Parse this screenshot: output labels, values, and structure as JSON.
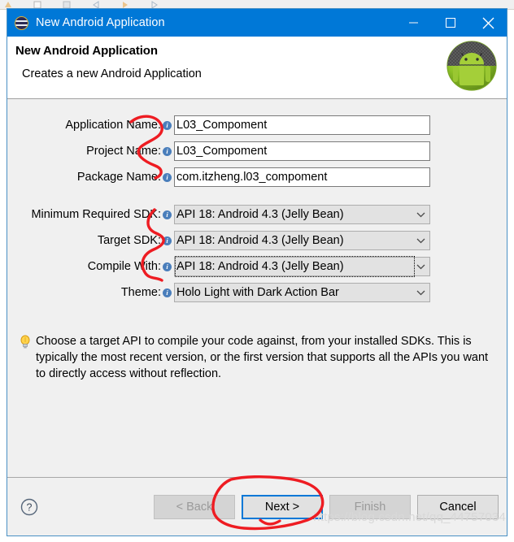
{
  "window": {
    "title": "New Android Application",
    "icon": "eclipse-icon",
    "controls": {
      "minimize": "minimize-icon",
      "maximize": "maximize-icon",
      "close": "close-icon"
    }
  },
  "header": {
    "title": "New Android Application",
    "subtitle": "Creates a new Android Application",
    "logo": "android-robot-icon"
  },
  "form": {
    "fields": [
      {
        "label": "Application Name:",
        "value": "L03_Compoment",
        "type": "text"
      },
      {
        "label": "Project Name:",
        "value": "L03_Compoment",
        "type": "text"
      },
      {
        "label": "Package Name:",
        "value": "com.itzheng.l03_compoment",
        "type": "text"
      }
    ],
    "dropdowns": [
      {
        "label": "Minimum Required SDK:",
        "value": "API 18: Android 4.3 (Jelly Bean)",
        "focused": false
      },
      {
        "label": "Target SDK:",
        "value": "API 18: Android 4.3 (Jelly Bean)",
        "focused": false
      },
      {
        "label": "Compile With:",
        "value": "API 18: Android 4.3 (Jelly Bean)",
        "focused": true
      },
      {
        "label": "Theme:",
        "value": "Holo Light with Dark Action Bar",
        "focused": false
      }
    ],
    "info_icon": "info-icon"
  },
  "tip": {
    "icon": "lightbulb-icon",
    "text": "Choose a target API to compile your code against, from your installed SDKs. This is typically the most recent version, or the first version that supports all the APIs you want to directly access without reflection."
  },
  "footer": {
    "help_icon": "help-icon",
    "buttons": [
      {
        "label": "< Back",
        "state": "disabled"
      },
      {
        "label": "Next >",
        "state": "default"
      },
      {
        "label": "Finish",
        "state": "disabled"
      },
      {
        "label": "Cancel",
        "state": "enabled"
      }
    ]
  },
  "watermark": "https://blog.csdn.net/qq_44757034",
  "colors": {
    "titlebar": "#0078d7",
    "accent": "#0078d7",
    "annotation": "#ee1c22",
    "dialog_bg": "#f0f0f0",
    "header_bg": "#ffffff"
  }
}
